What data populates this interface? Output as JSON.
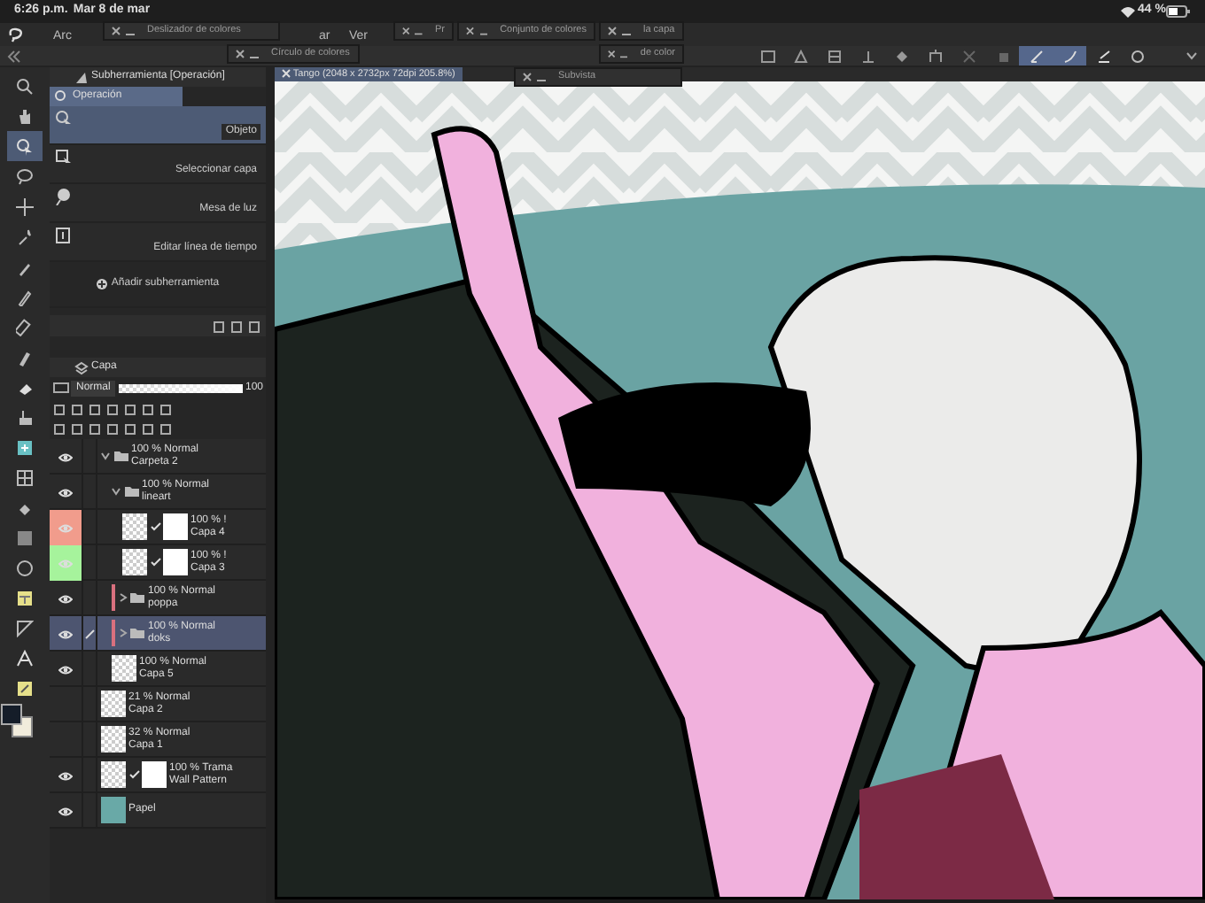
{
  "status_bar": {
    "time": "6:26 p.m.",
    "date": "Mar 8 de mar",
    "battery": "44 %"
  },
  "menu": [
    "Arc",
    "ar",
    "Ver"
  ],
  "palettes": [
    {
      "title": "Deslizador de colores"
    },
    {
      "title": "Pr"
    },
    {
      "title": "Conjunto de colores"
    },
    {
      "title": "la capa"
    },
    {
      "title": "Círculo de colores"
    },
    {
      "title": "de color"
    },
    {
      "title": "Subvista"
    }
  ],
  "toolbar": {
    "buttons": [
      {
        "selected": false
      },
      {
        "selected": false
      },
      {
        "selected": false
      },
      {
        "selected": false
      },
      {
        "selected": false
      },
      {
        "selected": false
      },
      {
        "selected": false
      },
      {
        "selected": false
      },
      {
        "selected": true
      },
      {
        "selected": true
      },
      {
        "selected": false
      },
      {
        "selected": false
      }
    ]
  },
  "tools": [
    {
      "selected": false
    },
    {
      "selected": false
    },
    {
      "selected": true
    },
    {
      "selected": false
    },
    {
      "selected": false
    },
    {
      "selected": false
    },
    {
      "selected": false
    },
    {
      "selected": false
    },
    {
      "selected": false
    },
    {
      "selected": false
    },
    {
      "selected": false
    },
    {
      "selected": false
    },
    {
      "selected": false
    },
    {
      "selected": false
    },
    {
      "selected": false
    },
    {
      "selected": false
    },
    {
      "selected": false
    },
    {
      "selected": false
    },
    {
      "selected": false
    },
    {
      "selected": false
    },
    {
      "selected": false
    }
  ],
  "subtool": {
    "title": "Subherramienta [Operación]",
    "group": {
      "label": "Operación",
      "selected": true
    },
    "items": [
      {
        "label": "Objeto",
        "selected": true
      },
      {
        "label": "Seleccionar capa",
        "selected": false
      },
      {
        "label": "Mesa de luz",
        "selected": false
      },
      {
        "label": "Editar línea de tiempo",
        "selected": false
      }
    ],
    "add": "Añadir subherramienta"
  },
  "layers": {
    "title": "Capa",
    "blend": "Normal",
    "opacity": "100",
    "opacity_slider": {
      "level": 1
    },
    "items": [
      {
        "kind": "folder",
        "info": "100 % Normal",
        "name": "Carpeta 2",
        "visible": true,
        "expanded": true,
        "selected": false,
        "children": [
          {
            "kind": "folder",
            "info": "100 % Normal",
            "name": "lineart",
            "visible": true,
            "expanded": true,
            "selected": false,
            "children": [
              {
                "kind": "masked",
                "info": "100 % !",
                "name": "Capa 4",
                "visible": true,
                "selected": false,
                "color": "#f19c8c"
              },
              {
                "kind": "masked",
                "info": "100 % !",
                "name": "Capa 3",
                "visible": true,
                "selected": false,
                "color": "#a6f39c"
              }
            ]
          },
          {
            "kind": "folder",
            "info": "100 % Normal",
            "name": "poppa",
            "visible": true,
            "expanded": false,
            "selected": false,
            "color": "#d9707e"
          },
          {
            "kind": "folder",
            "info": "100 % Normal",
            "name": "doks",
            "visible": true,
            "expanded": false,
            "selected": true,
            "color": "#d9707e"
          },
          {
            "kind": "raster",
            "info": "100 % Normal",
            "name": "Capa 5",
            "visible": true,
            "selected": false
          }
        ]
      },
      {
        "kind": "raster",
        "info": "21 % Normal",
        "name": "Capa 2",
        "visible": false,
        "selected": false
      },
      {
        "kind": "raster",
        "info": "32 % Normal",
        "name": "Capa 1",
        "visible": false,
        "selected": false
      },
      {
        "kind": "masked",
        "info": "100 % Trama",
        "name": "Wall Pattern",
        "visible": true,
        "selected": false
      },
      {
        "kind": "paper",
        "name": "Papel",
        "visible": true,
        "selected": false
      }
    ]
  },
  "canvas": {
    "tab": "Tango (2048 x 2732px 72dpi 205.8%)"
  }
}
